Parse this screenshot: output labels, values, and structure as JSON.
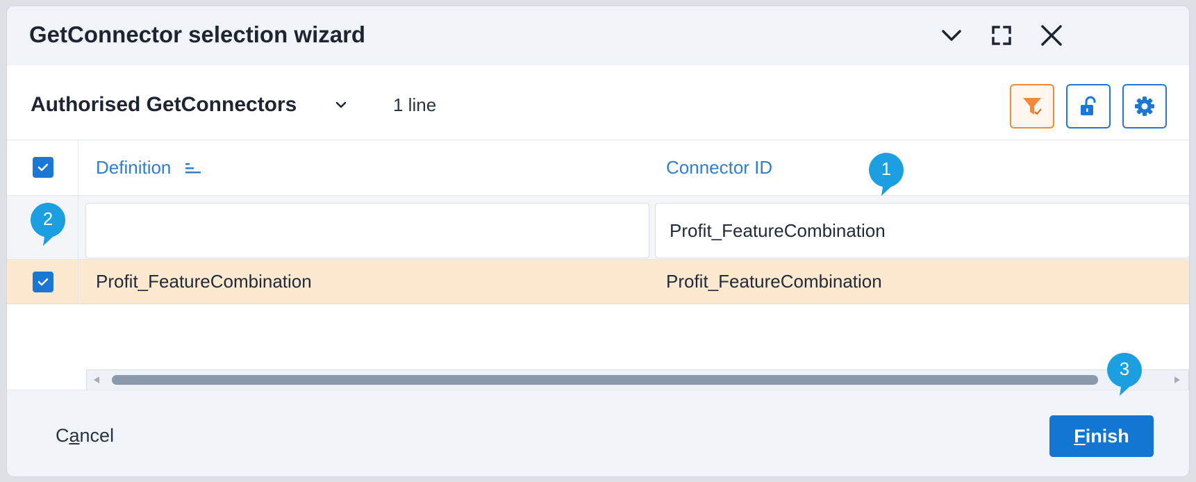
{
  "dialog": {
    "title": "GetConnector selection wizard",
    "icons": [
      "chevron-down-icon",
      "expand-icon",
      "close-icon"
    ]
  },
  "toolbar": {
    "view_name": "Authorised GetConnectors",
    "line_count": "1 line",
    "buttons": [
      "filter-icon",
      "unlock-icon",
      "gear-icon"
    ]
  },
  "grid": {
    "columns": [
      {
        "label": "Definition",
        "sorted": true
      },
      {
        "label": "Connector ID"
      }
    ],
    "filters": {
      "definition": "",
      "connector_id": "Profit_FeatureCombination"
    },
    "rows": [
      {
        "selected": true,
        "definition": "Profit_FeatureCombination",
        "connector_id": "Profit_FeatureCombination"
      }
    ],
    "header_checked": true
  },
  "footer": {
    "cancel_pre": "C",
    "cancel_key": "a",
    "cancel_post": "ncel",
    "finish_key": "F",
    "finish_post": "inish"
  },
  "callouts": [
    "1",
    "2",
    "3"
  ],
  "colors": {
    "accent": "#1476d3",
    "selected_row": "#fde8d0",
    "filter_active": "#f0893a",
    "callout": "#1b9fe0"
  }
}
